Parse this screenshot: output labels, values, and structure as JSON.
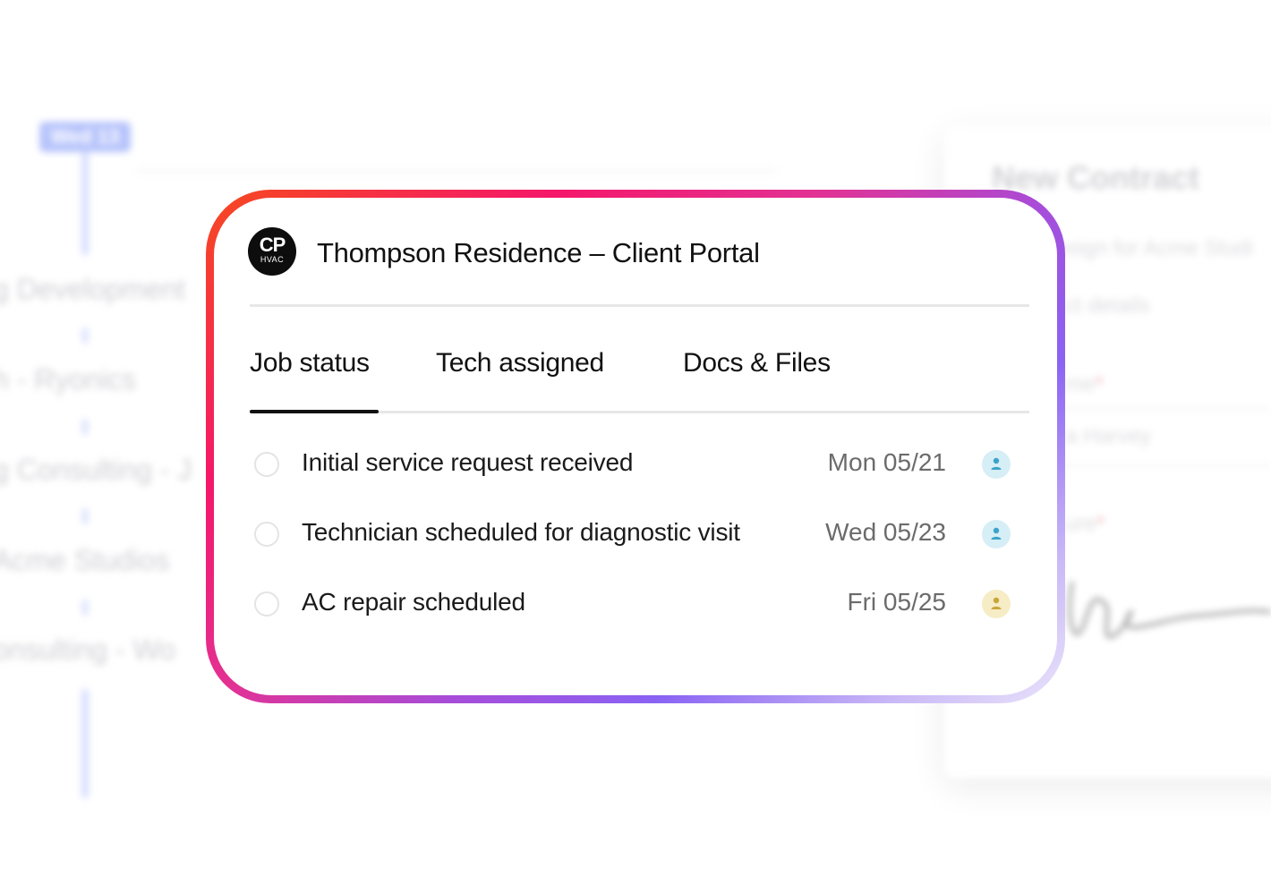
{
  "background": {
    "timeline_tag": "Wed 13",
    "timeline_items": [
      "g Development",
      "h - Ryonics",
      "g Consulting - J",
      "Acme Studios",
      "onsulting - Wo"
    ],
    "contract_panel": {
      "title": "New Contract",
      "subtitle": "esign for Acme Studi",
      "details_label": "ct details",
      "name_label": "me",
      "name_value": "a Harvey",
      "signature_label": "ure"
    }
  },
  "card": {
    "logo": {
      "main": "CP",
      "sub": "HVAC"
    },
    "title": "Thompson Residence – Client Portal",
    "tabs": [
      {
        "label": "Job status",
        "active": true
      },
      {
        "label": "Tech assigned",
        "active": false
      },
      {
        "label": "Docs & Files",
        "active": false
      }
    ],
    "tasks": [
      {
        "label": "Initial service request received",
        "date": "Mon 05/21",
        "avatar_icon": "user-icon",
        "avatar_color": "#d6eef6",
        "avatar_fg": "#3aa3c9"
      },
      {
        "label": "Technician scheduled for diagnostic visit",
        "date": "Wed 05/23",
        "avatar_icon": "user-icon",
        "avatar_color": "#d6eef6",
        "avatar_fg": "#3aa3c9"
      },
      {
        "label": "AC repair scheduled",
        "date": "Fri 05/25",
        "avatar_icon": "user-icon",
        "avatar_color": "#f6ecc6",
        "avatar_fg": "#c9a53a"
      }
    ]
  }
}
